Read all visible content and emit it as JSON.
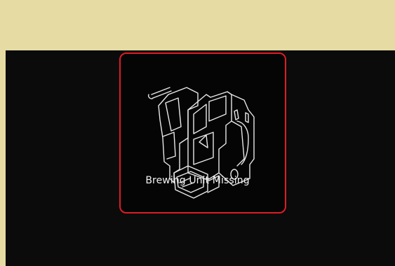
{
  "screen": {
    "message": "Brewing Unit Missing",
    "illustration_icon": "brewing-unit-icon",
    "colors": {
      "top_band": "#e6dca3",
      "display_background": "#0b0b0b",
      "frame_border": "#e01b24",
      "text": "#f2f2f2"
    }
  }
}
